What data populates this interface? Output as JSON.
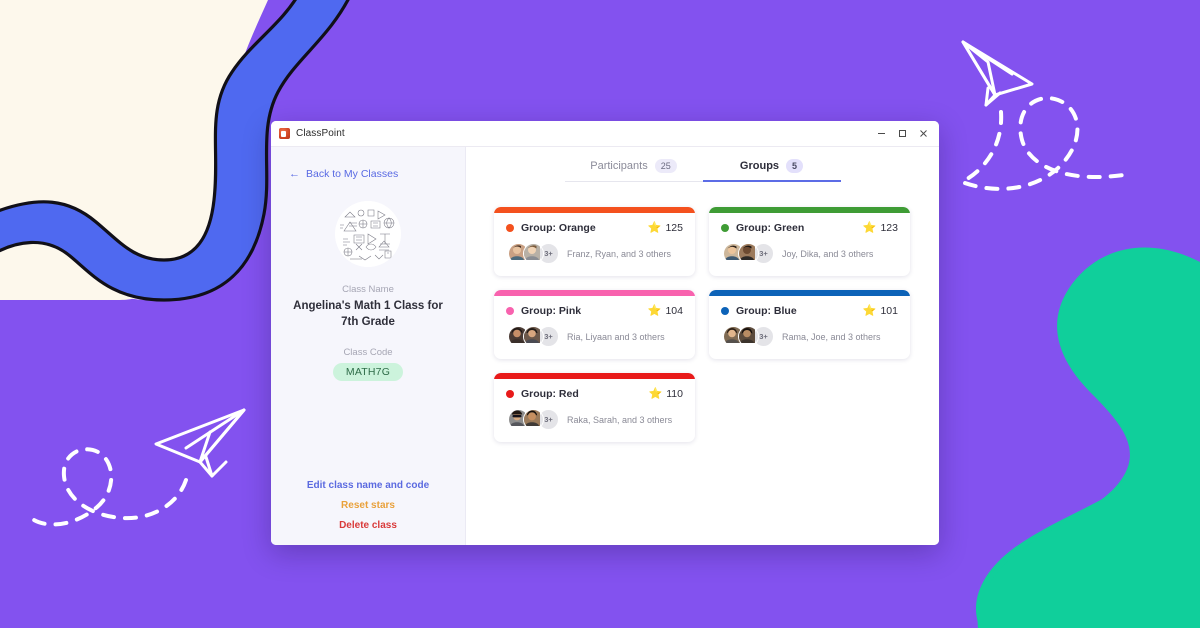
{
  "background": {
    "purple": "#8352ef",
    "cream": "#fdf8ec",
    "ribbon_blue": "#4f69f0",
    "ribbon_violet": "#7a45f0",
    "teal": "#10cf9b",
    "decor": [
      "paper-plane-top-right",
      "paper-plane-bottom-left",
      "dashed-loop-trail",
      "blue-wave-ribbon",
      "cream-blob",
      "teal-wave-blob"
    ]
  },
  "window": {
    "title": "ClassPoint",
    "app_icon": "classpoint-icon",
    "controls": {
      "minimize": "minimize-icon",
      "maximize": "maximize-icon",
      "close": "close-icon"
    }
  },
  "sidebar": {
    "back_link": {
      "label": "Back to My Classes",
      "icon": "arrow-left-icon"
    },
    "avatar": "math-doodles-class-avatar",
    "class_name_label": "Class Name",
    "class_name": "Angelina's Math 1 Class for 7th Grade",
    "class_code_label": "Class Code",
    "class_code": "MATH7G",
    "actions": [
      {
        "label": "Edit class name and code",
        "color": "#5b6ae0"
      },
      {
        "label": "Reset stars",
        "color": "#e9a13b"
      },
      {
        "label": "Delete class",
        "color": "#d93a3a"
      }
    ]
  },
  "main": {
    "tabs": [
      {
        "label": "Participants",
        "count": "25",
        "active": false
      },
      {
        "label": "Groups",
        "count": "5",
        "active": true
      }
    ],
    "groups": [
      {
        "name": "Group: Orange",
        "color": "#f4511e",
        "stars": "125",
        "star_icon": "star-icon",
        "members": "Franz, Ryan, and 3 others",
        "more_count": "3+"
      },
      {
        "name": "Group: Green",
        "color": "#3f9c35",
        "stars": "123",
        "star_icon": "star-icon",
        "members": "Joy, Dika, and 3 others",
        "more_count": "3+"
      },
      {
        "name": "Group: Pink",
        "color": "#f862ae",
        "stars": "104",
        "star_icon": "star-icon",
        "members": "Ria, Liyaan and 3 others",
        "more_count": "3+"
      },
      {
        "name": "Group: Blue",
        "color": "#0d63b8",
        "stars": "101",
        "star_icon": "star-icon",
        "members": "Rama, Joe, and 3 others",
        "more_count": "3+"
      },
      {
        "name": "Group: Red",
        "color": "#e81a1a",
        "stars": "110",
        "star_icon": "star-icon",
        "members": "Raka, Sarah, and 3 others",
        "more_count": "3+"
      }
    ]
  }
}
